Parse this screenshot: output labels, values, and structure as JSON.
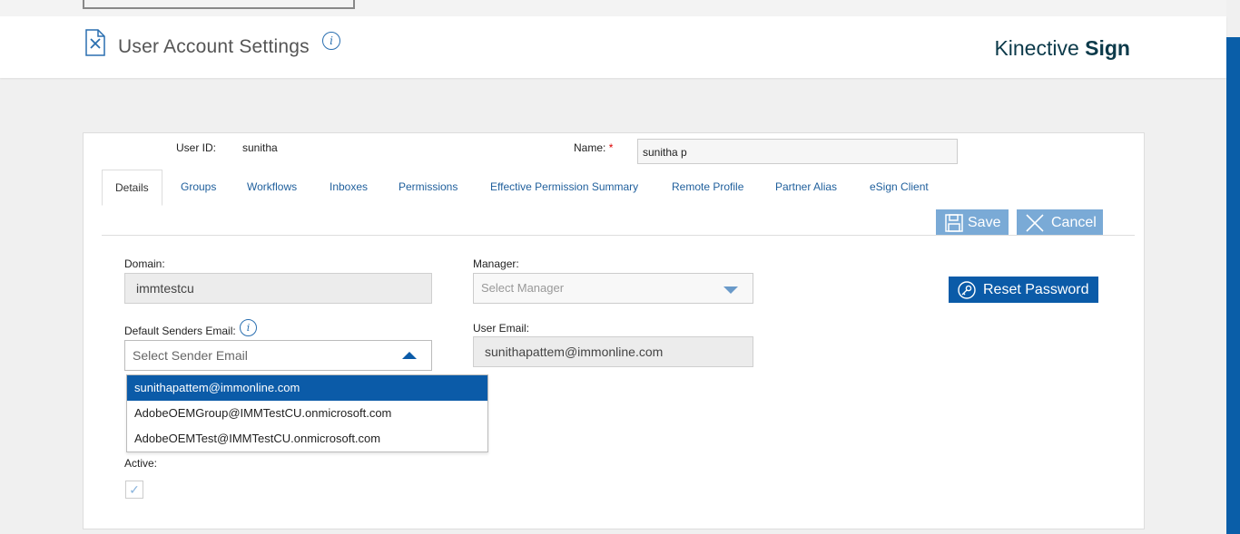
{
  "header": {
    "title": "User Account Settings",
    "brand_light": "Kinective",
    "brand_bold": "Sign"
  },
  "user": {
    "user_id_label": "User ID:",
    "user_id_value": "sunitha",
    "name_label": "Name:",
    "name_required": "*",
    "name_value": "sunitha p"
  },
  "tabs": [
    {
      "label": "Details",
      "active": true
    },
    {
      "label": "Groups"
    },
    {
      "label": "Workflows"
    },
    {
      "label": "Inboxes"
    },
    {
      "label": "Permissions"
    },
    {
      "label": "Effective Permission Summary"
    },
    {
      "label": "Remote Profile"
    },
    {
      "label": "Partner Alias"
    },
    {
      "label": "eSign Client"
    }
  ],
  "actions": {
    "save_label": "Save",
    "cancel_label": "Cancel",
    "reset_password_label": "Reset Password"
  },
  "form": {
    "domain_label": "Domain:",
    "domain_value": "immtestcu",
    "manager_label": "Manager:",
    "manager_placeholder": "Select Manager",
    "default_senders_label": "Default Senders Email:",
    "sender_placeholder": "Select Sender Email",
    "user_email_label": "User Email:",
    "user_email_value": "sunithapattem@immonline.com",
    "active_label": "Active:",
    "active_checked": true
  },
  "sender_options": [
    {
      "label": "sunithapattem@immonline.com",
      "selected": true
    },
    {
      "label": "AdobeOEMGroup@IMMTestCU.onmicrosoft.com"
    },
    {
      "label": "AdobeOEMTest@IMMTestCU.onmicrosoft.com"
    }
  ],
  "colors": {
    "accent": "#0b5ba8",
    "button_light": "#7aaad6",
    "brand_text": "#0c3a4a"
  }
}
